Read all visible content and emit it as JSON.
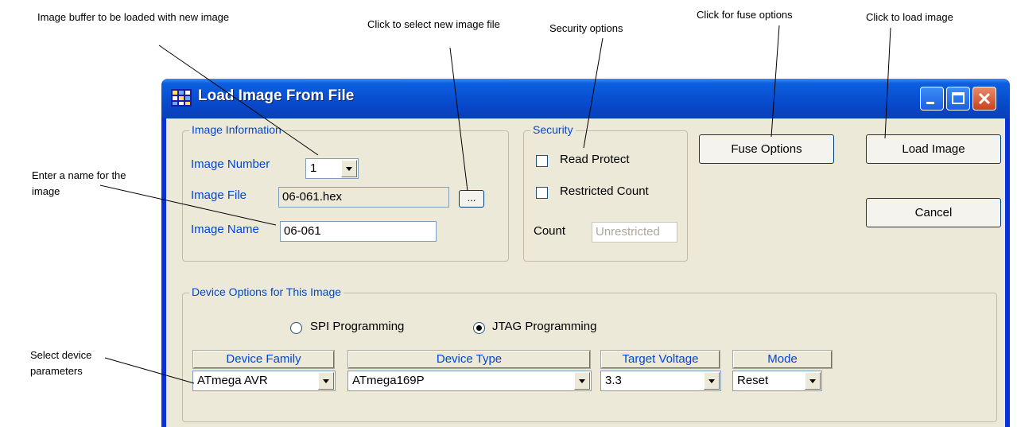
{
  "annotations": {
    "image_buffer": "Image buffer to be loaded with new image",
    "select_file": "Click to select new image file",
    "security": "Security options",
    "fuse": "Click for fuse options",
    "load": "Click to load image",
    "enter_name": "Enter a name for the image",
    "select_device": "Select device parameters"
  },
  "window": {
    "title": "Load Image From File",
    "icon": "app-grid-icon",
    "caption_buttons": [
      "minimize-icon",
      "maximize-icon",
      "close-icon"
    ]
  },
  "image_info": {
    "group_title": "Image Information",
    "number_label": "Image Number",
    "number_value": "1",
    "file_label": "Image File",
    "file_value": "06-061.hex",
    "browse_label": "...",
    "name_label": "Image Name",
    "name_value": "06-061"
  },
  "security": {
    "group_title": "Security",
    "read_protect_label": "Read Protect",
    "read_protect_checked": false,
    "restricted_label": "Restricted Count",
    "restricted_checked": false,
    "count_label": "Count",
    "count_value": "Unrestricted"
  },
  "buttons": {
    "fuse_options": "Fuse Options",
    "load_image": "Load Image",
    "cancel": "Cancel"
  },
  "device_options": {
    "group_title": "Device Options for This Image",
    "spi_label": "SPI Programming",
    "jtag_label": "JTAG Programming",
    "selected_mode": "JTAG Programming",
    "family_header": "Device Family",
    "family_value": "ATmega AVR",
    "type_header": "Device Type",
    "type_value": "ATmega169P",
    "voltage_header": "Target Voltage",
    "voltage_value": "3.3",
    "mode_header": "Mode",
    "mode_value": "Reset"
  },
  "colors": {
    "title_bar": "#0847c9",
    "dialog_bg": "#ece9d8",
    "label_blue": "#0046d5"
  }
}
